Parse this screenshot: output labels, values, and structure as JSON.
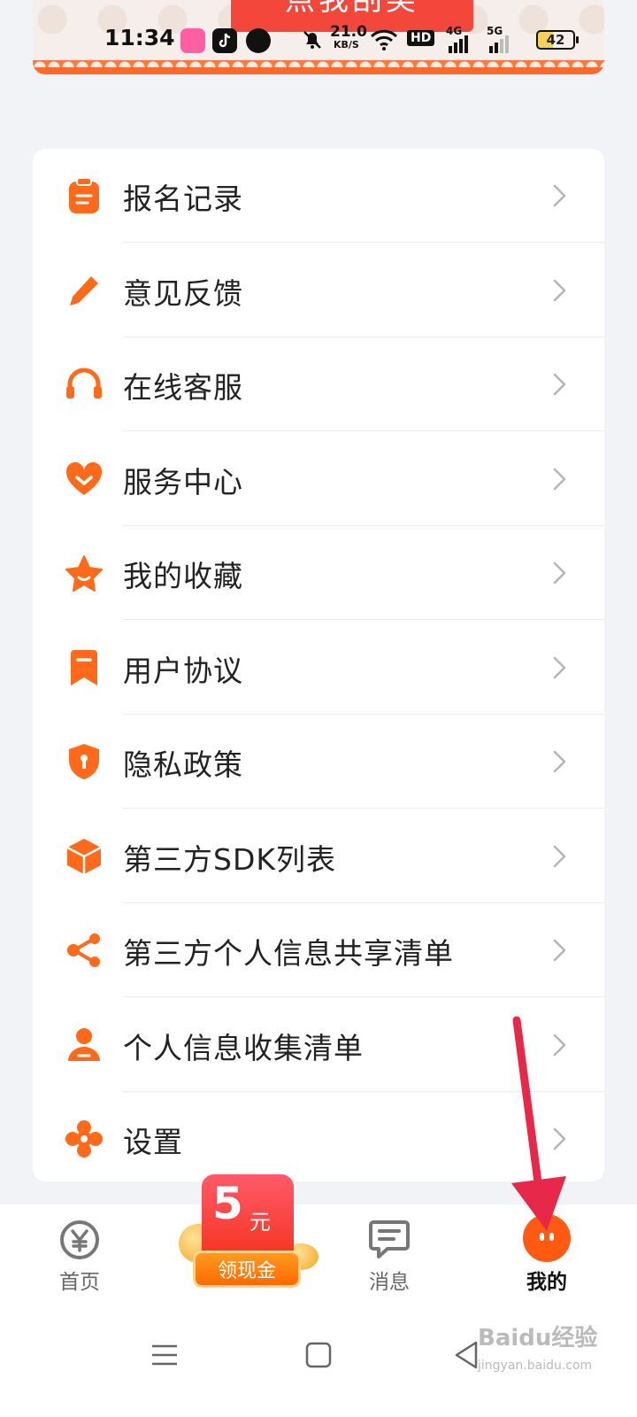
{
  "banner": {
    "button_label": "点我刮奖"
  },
  "status_bar": {
    "time": "11:34",
    "speed_value": "21.0",
    "speed_unit": "KB/S",
    "hd_label": "HD",
    "signal1_label": "4G",
    "signal2_label": "5G",
    "battery": "42"
  },
  "menu": {
    "items": [
      {
        "label": "报名记录",
        "icon": "clipboard-icon"
      },
      {
        "label": "意见反馈",
        "icon": "pencil-icon"
      },
      {
        "label": "在线客服",
        "icon": "headset-icon"
      },
      {
        "label": "服务中心",
        "icon": "heart-icon"
      },
      {
        "label": "我的收藏",
        "icon": "star-icon"
      },
      {
        "label": "用户协议",
        "icon": "bookmark-icon"
      },
      {
        "label": "隐私政策",
        "icon": "shield-icon"
      },
      {
        "label": "第三方SDK列表",
        "icon": "cube-icon"
      },
      {
        "label": "第三方个人信息共享清单",
        "icon": "share-icon"
      },
      {
        "label": "个人信息收集清单",
        "icon": "person-icon"
      },
      {
        "label": "设置",
        "icon": "settings-icon"
      }
    ]
  },
  "tabbar": {
    "home_label": "首页",
    "promo_amount": "5",
    "promo_unit": "元",
    "promo_label": "领现金",
    "messages_label": "消息",
    "mine_label": "我的",
    "active_tab": "我的"
  },
  "colors": {
    "accent": "#ff6a1a",
    "arrow": "#e8284a",
    "promo_red": "#f5331e"
  },
  "watermark": {
    "title": "Baidu经验",
    "sub": "jingyan.baidu.com"
  }
}
